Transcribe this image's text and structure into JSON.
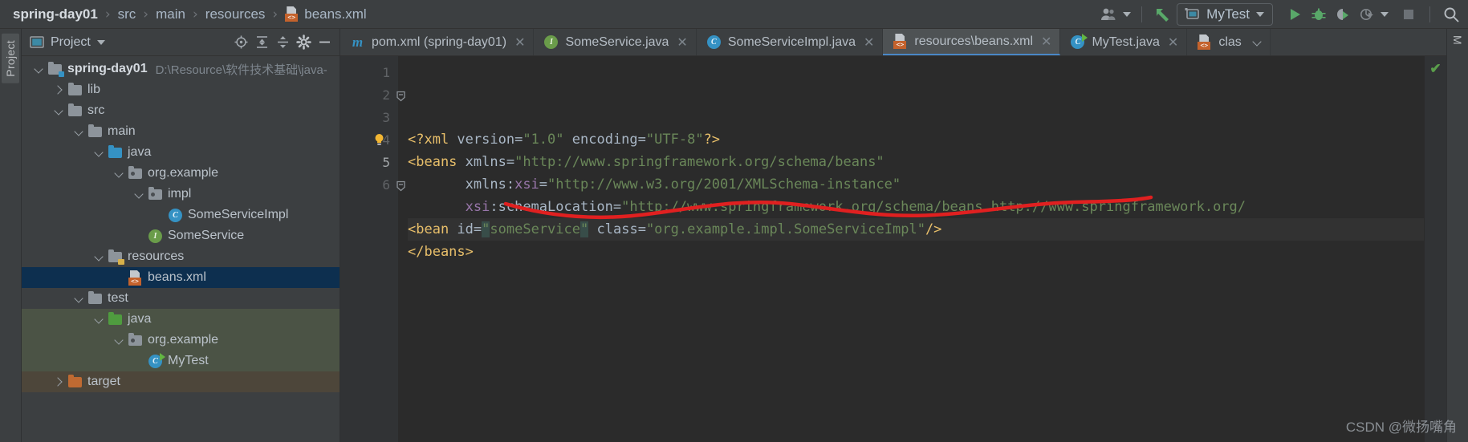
{
  "window": {
    "breadcrumb": [
      {
        "label": "spring-day01",
        "icon": "none",
        "bold": true
      },
      {
        "label": "src",
        "icon": "none",
        "bold": false
      },
      {
        "label": "main",
        "icon": "none",
        "bold": false
      },
      {
        "label": "resources",
        "icon": "none",
        "bold": false
      },
      {
        "label": "beans.xml",
        "icon": "xml-file-icon",
        "bold": false
      }
    ],
    "separator": "›"
  },
  "toolbar": {
    "user_icon": "users-icon",
    "update_icon": "update-project-arrow-icon",
    "run_config": "MyTest",
    "run_icon": "run-icon",
    "debug_icon": "debug-bug-icon",
    "coverage_icon": "run-with-coverage-icon",
    "profiler_icon": "profiler-icon",
    "stop_icon": "stop-icon",
    "search_icon": "search-everywhere-icon"
  },
  "left_rail": {
    "tab_label": "Project"
  },
  "right_rail": {
    "tab_label": "M"
  },
  "project_panel": {
    "title": "Project",
    "icons": [
      "locate-file-icon",
      "expand-all-icon",
      "collapse-all-icon",
      "settings-gear-icon",
      "hide-panel-icon"
    ],
    "tree": [
      {
        "label": "spring-day01",
        "path": "D:\\Resource\\软件技术基础\\java-",
        "indent": 0,
        "chev": "down",
        "icon": "module-folder-icon",
        "bold": true,
        "state": "normal"
      },
      {
        "label": "lib",
        "path": "",
        "indent": 1,
        "chev": "right",
        "icon": "folder-icon",
        "bold": false,
        "state": "normal"
      },
      {
        "label": "src",
        "path": "",
        "indent": 1,
        "chev": "down",
        "icon": "folder-icon",
        "bold": false,
        "state": "normal"
      },
      {
        "label": "main",
        "path": "",
        "indent": 2,
        "chev": "down",
        "icon": "folder-icon",
        "bold": false,
        "state": "normal"
      },
      {
        "label": "java",
        "path": "",
        "indent": 3,
        "chev": "down",
        "icon": "source-folder-icon",
        "bold": false,
        "state": "normal"
      },
      {
        "label": "org.example",
        "path": "",
        "indent": 4,
        "chev": "down",
        "icon": "package-icon",
        "bold": false,
        "state": "normal"
      },
      {
        "label": "impl",
        "path": "",
        "indent": 5,
        "chev": "down",
        "icon": "package-icon",
        "bold": false,
        "state": "normal"
      },
      {
        "label": "SomeServiceImpl",
        "path": "",
        "indent": 6,
        "chev": "none",
        "icon": "class-icon",
        "bold": false,
        "state": "normal"
      },
      {
        "label": "SomeService",
        "path": "",
        "indent": 5,
        "chev": "none",
        "icon": "interface-icon",
        "bold": false,
        "state": "normal"
      },
      {
        "label": "resources",
        "path": "",
        "indent": 3,
        "chev": "down",
        "icon": "resources-folder-icon",
        "bold": false,
        "state": "normal"
      },
      {
        "label": "beans.xml",
        "path": "",
        "indent": 4,
        "chev": "none",
        "icon": "xml-file-icon",
        "bold": false,
        "state": "selected"
      },
      {
        "label": "test",
        "path": "",
        "indent": 2,
        "chev": "down",
        "icon": "folder-icon",
        "bold": false,
        "state": "normal"
      },
      {
        "label": "java",
        "path": "",
        "indent": 3,
        "chev": "down",
        "icon": "test-source-folder-icon",
        "bold": false,
        "state": "test"
      },
      {
        "label": "org.example",
        "path": "",
        "indent": 4,
        "chev": "down",
        "icon": "package-icon",
        "bold": false,
        "state": "test"
      },
      {
        "label": "MyTest",
        "path": "",
        "indent": 5,
        "chev": "none",
        "icon": "test-class-icon",
        "bold": false,
        "state": "test"
      },
      {
        "label": "target",
        "path": "",
        "indent": 1,
        "chev": "right",
        "icon": "excluded-folder-icon",
        "bold": false,
        "state": "target"
      }
    ]
  },
  "editor_tabs": [
    {
      "label": "pom.xml (spring-day01)",
      "icon": "maven-icon",
      "active": false,
      "closable": true
    },
    {
      "label": "SomeService.java",
      "icon": "interface-icon",
      "active": false,
      "closable": true
    },
    {
      "label": "SomeServiceImpl.java",
      "icon": "class-icon",
      "active": false,
      "closable": true
    },
    {
      "label": "resources\\beans.xml",
      "icon": "xml-file-icon",
      "active": true,
      "closable": true
    },
    {
      "label": "MyTest.java",
      "icon": "test-class-icon",
      "active": false,
      "closable": true
    },
    {
      "label": "clas",
      "icon": "xml-file-icon",
      "active": false,
      "closable": false,
      "overflow": true
    }
  ],
  "editor": {
    "line_numbers": [
      "1",
      "2",
      "3",
      "4",
      "5",
      "6"
    ],
    "current_line": 5,
    "inspection_status": "✔",
    "lines": [
      {
        "n": 1,
        "tokens": [
          {
            "t": "<?xml ",
            "c": "tag"
          },
          {
            "t": "version",
            "c": "attr"
          },
          {
            "t": "=",
            "c": "punc"
          },
          {
            "t": "\"1.0\"",
            "c": "val"
          },
          {
            "t": " ",
            "c": "punc"
          },
          {
            "t": "encoding",
            "c": "attr"
          },
          {
            "t": "=",
            "c": "punc"
          },
          {
            "t": "\"UTF-8\"",
            "c": "val"
          },
          {
            "t": "?>",
            "c": "tag"
          }
        ]
      },
      {
        "n": 2,
        "tokens": [
          {
            "t": "<beans ",
            "c": "tag"
          },
          {
            "t": "xmlns",
            "c": "attr"
          },
          {
            "t": "=",
            "c": "punc"
          },
          {
            "t": "\"http://www.springframework.org/schema/beans\"",
            "c": "val"
          }
        ]
      },
      {
        "n": 3,
        "tokens": [
          {
            "t": "       ",
            "c": "punc"
          },
          {
            "t": "xmlns:",
            "c": "attr"
          },
          {
            "t": "xsi",
            "c": "pfx"
          },
          {
            "t": "=",
            "c": "punc"
          },
          {
            "t": "\"http://www.w3.org/2001/XMLSchema-instance\"",
            "c": "val"
          }
        ]
      },
      {
        "n": 4,
        "tokens": [
          {
            "t": "       ",
            "c": "punc"
          },
          {
            "t": "xsi",
            "c": "pfx"
          },
          {
            "t": ":schemaLocation",
            "c": "attr"
          },
          {
            "t": "=",
            "c": "punc"
          },
          {
            "t": "\"http://www.springframework.org/schema/beans http://www.springframework.org/",
            "c": "val"
          }
        ]
      },
      {
        "n": 5,
        "tokens": [
          {
            "t": "<bean ",
            "c": "tag"
          },
          {
            "t": "id",
            "c": "attr"
          },
          {
            "t": "=",
            "c": "punc"
          },
          {
            "t": "\"",
            "c": "val qmark"
          },
          {
            "t": "someService",
            "c": "val"
          },
          {
            "t": "\"",
            "c": "val qmark"
          },
          {
            "t": " ",
            "c": "punc"
          },
          {
            "t": "class",
            "c": "attr"
          },
          {
            "t": "=",
            "c": "punc"
          },
          {
            "t": "\"org.example.impl.SomeServiceImpl\"",
            "c": "val"
          },
          {
            "t": "/>",
            "c": "tag"
          }
        ]
      },
      {
        "n": 6,
        "tokens": [
          {
            "t": "</beans>",
            "c": "tag"
          }
        ]
      }
    ],
    "annotation": {
      "type": "hand-drawn-underline",
      "color": "#e02020",
      "target_text": "class=\"org.example.impl.SomeServiceImpl\""
    },
    "bulb_line": 4,
    "fold_lines": [
      2,
      6
    ]
  },
  "watermark": "CSDN @微扬嘴角",
  "colors": {
    "bg": "#3c3f41",
    "editor_bg": "#2b2b2b",
    "gutter_bg": "#313335",
    "selection": "#0d2f4f",
    "accent": "#4a88c7",
    "tag": "#e8bf6a",
    "string": "#6a8759",
    "prefix": "#9876aa",
    "annotation_red": "#e02020"
  }
}
